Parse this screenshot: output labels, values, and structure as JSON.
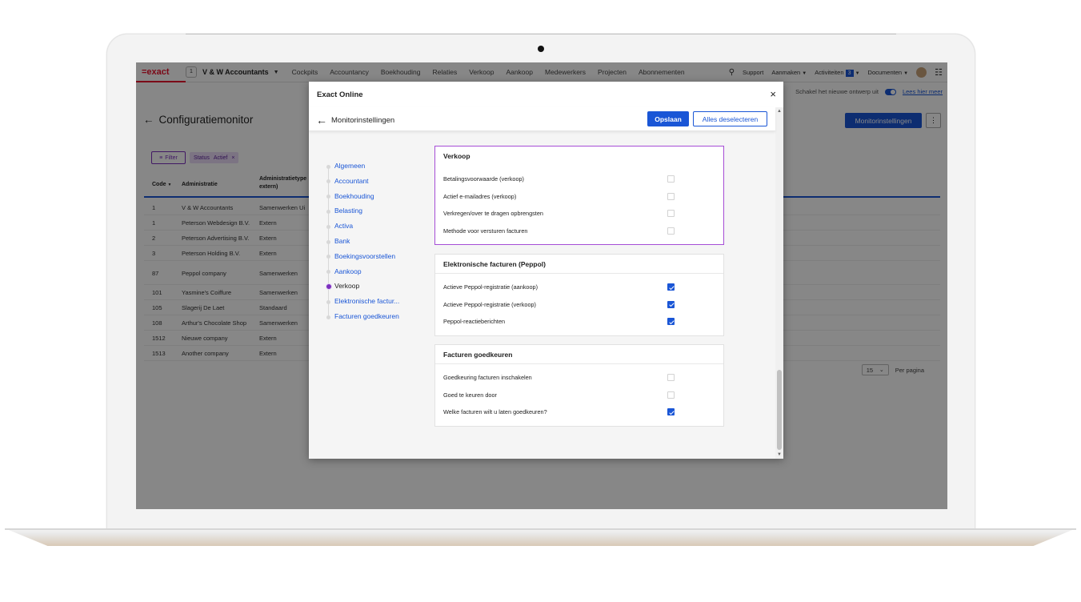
{
  "topnav": {
    "logo": "=exact",
    "account_badge": "1",
    "account_name": "V & W Accountants",
    "menu": [
      "Cockpits",
      "Accountancy",
      "Boekhouding",
      "Relaties",
      "Verkoop",
      "Aankoop",
      "Medewerkers",
      "Projecten",
      "Abonnementen"
    ],
    "support": "Support",
    "aanmaken": "Aanmaken",
    "activiteiten": "Activiteiten",
    "activiteiten_count": "3",
    "documenten": "Documenten"
  },
  "subbar": {
    "toggle_label": "Schakel het nieuwe ontwerp uit",
    "link": "Lees hier meer"
  },
  "page": {
    "title": "Configuratiemonitor",
    "monitor_button": "Monitorinstellingen",
    "more_button": "⋮"
  },
  "filters": {
    "filter_button": "Filter",
    "chip_label": "Status",
    "chip_value": "Actief",
    "chip_remove": "×"
  },
  "table": {
    "headers": [
      "Code",
      "Administratie",
      "Administratietype extern)"
    ],
    "sort_icon": "▼",
    "rows": [
      {
        "code": "1",
        "name": "V & W Accountants",
        "type": "Samenwerken Ui"
      },
      {
        "code": "1",
        "name": "Peterson Webdesign B.V.",
        "type": "Extern"
      },
      {
        "code": "2",
        "name": "Peterson Advertising B.V.",
        "type": "Extern"
      },
      {
        "code": "3",
        "name": "Peterson Holding B.V.",
        "type": "Extern"
      },
      {
        "code": "87",
        "name": "Peppol company",
        "type": "Samenwerken"
      },
      {
        "code": "101",
        "name": "Yasmine's Coiffure",
        "type": "Samenwerken"
      },
      {
        "code": "105",
        "name": "Slagerij De Laet",
        "type": "Standaard"
      },
      {
        "code": "108",
        "name": "Arthur's Chocolate Shop",
        "type": "Samenwerken"
      },
      {
        "code": "1512",
        "name": "Nieuwe company",
        "type": "Extern"
      },
      {
        "code": "1513",
        "name": "Another company",
        "type": "Extern"
      }
    ],
    "page_size": "15",
    "per_page_label": "Per pagina"
  },
  "modal": {
    "title": "Exact Online",
    "close": "×",
    "sub_title": "Monitorinstellingen",
    "save_button": "Opslaan",
    "deselect_button": "Alles deselecteren",
    "nav": [
      "Algemeen",
      "Accountant",
      "Boekhouding",
      "Belasting",
      "Activa",
      "Bank",
      "Boekingsvoorstellen",
      "Aankoop",
      "Verkoop",
      "Elektronische factur...",
      "Facturen goedkeuren"
    ],
    "sections": [
      {
        "title": "Verkoop",
        "rows": [
          {
            "label": "Betalingsvoorwaarde (verkoop)",
            "checked": false
          },
          {
            "label": "Actief e-mailadres (verkoop)",
            "checked": false
          },
          {
            "label": "Verkregen/over te dragen opbrengsten",
            "checked": false
          },
          {
            "label": "Methode voor versturen facturen",
            "checked": false
          }
        ]
      },
      {
        "title": "Elektronische facturen (Peppol)",
        "rows": [
          {
            "label": "Actieve Peppol-registratie (aankoop)",
            "checked": true
          },
          {
            "label": "Actieve Peppol-registratie (verkoop)",
            "checked": true
          },
          {
            "label": "Peppol-reactieberichten",
            "checked": true
          }
        ]
      },
      {
        "title": "Facturen goedkeuren",
        "rows": [
          {
            "label": "Goedkeuring facturen inschakelen",
            "checked": false
          },
          {
            "label": "Goed te keuren door",
            "checked": false
          },
          {
            "label": "Welke facturen wilt u laten goedkeuren?",
            "checked": true
          }
        ]
      }
    ]
  },
  "colors": {
    "brand_red": "#e8112d",
    "primary_blue": "#1a56d6",
    "accent_purple": "#7b2fbe"
  }
}
